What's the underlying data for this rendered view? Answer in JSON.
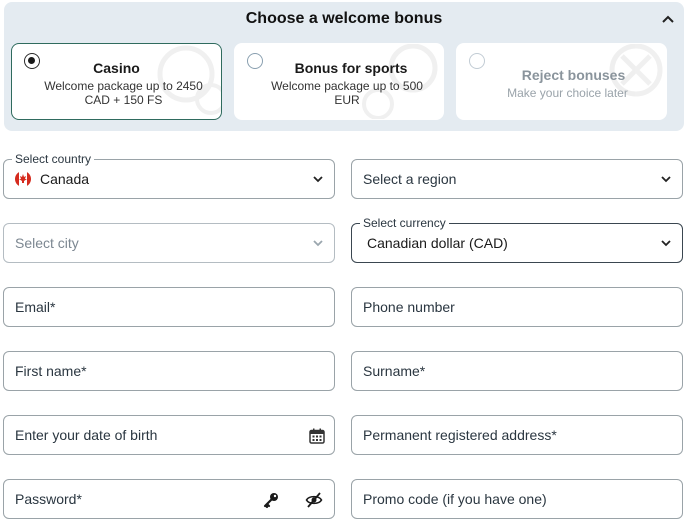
{
  "bonus": {
    "title": "Choose a welcome bonus",
    "options": [
      {
        "title": "Casino",
        "description": "Welcome package up to 2450 CAD + 150 FS",
        "selected": true
      },
      {
        "title": "Bonus for sports",
        "description": "Welcome package up to 500 EUR",
        "selected": false
      },
      {
        "title": "Reject bonuses",
        "description": "Make your choice later",
        "selected": false
      }
    ]
  },
  "form": {
    "country": {
      "label": "Select country",
      "value": "Canada",
      "flag_icon": "canada-flag-icon"
    },
    "region": {
      "placeholder": "Select a region"
    },
    "city": {
      "placeholder": "Select city"
    },
    "currency": {
      "label": "Select currency",
      "value": "Canadian dollar (CAD)"
    },
    "email": {
      "placeholder": "Email*"
    },
    "phone": {
      "placeholder": "Phone number"
    },
    "first_name": {
      "placeholder": "First name*"
    },
    "surname": {
      "placeholder": "Surname*"
    },
    "dob": {
      "placeholder": "Enter your date of birth",
      "icon": "calendar-icon"
    },
    "address": {
      "placeholder": "Permanent registered address*"
    },
    "password": {
      "placeholder": "Password*",
      "icons": [
        "key-icon",
        "eye-off-icon"
      ]
    },
    "promo": {
      "placeholder": "Promo code (if you have one)"
    }
  },
  "colors": {
    "panel_bg": "#e4ebf1",
    "selected_border": "#2f6b5e",
    "field_border": "#9aa3a8"
  }
}
